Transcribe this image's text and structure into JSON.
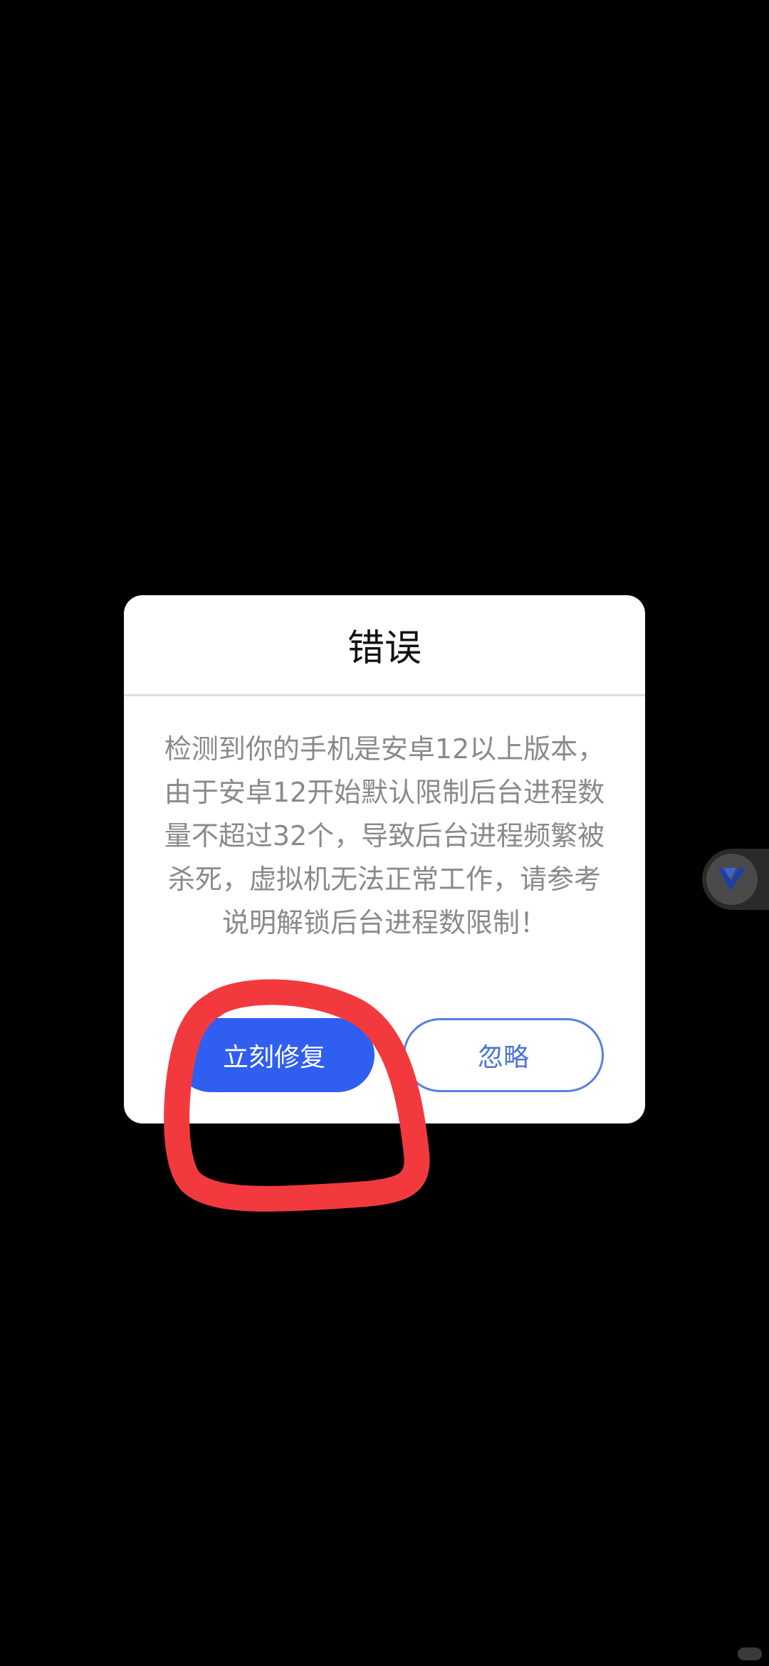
{
  "dialog": {
    "title": "错误",
    "message": "检测到你的手机是安卓12以上版本，由于安卓12开始默认限制后台进程数量不超过32个，导致后台进程频繁被杀死，虚拟机无法正常工作，请参考说明解锁后台进程数限制！",
    "fix_button_label": "立刻修复",
    "ignore_button_label": "忽略"
  },
  "overlay": {
    "floating_ball_icon": "v-logo-icon",
    "annotation_color": "#f23a3e"
  },
  "colors": {
    "background": "#000000",
    "primary_button": "#2f5ef0",
    "secondary_button_text": "#4a73d6"
  }
}
